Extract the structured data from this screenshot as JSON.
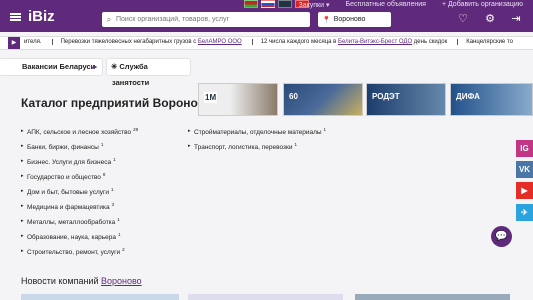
{
  "header": {
    "logo": "iBiz",
    "search_placeholder": "Поиск организаций, товаров, услуг",
    "city": "Вороново",
    "links": [
      "Закупки ▾",
      "Бесплатные объявления",
      "+ Добавить организацию"
    ]
  },
  "ticker": {
    "items": [
      {
        "text": "",
        "link": "ителя."
      },
      {
        "text": "Перевозки тяжеловесных негабаритных грузов с ",
        "link": "БелАМРО ООО"
      },
      {
        "text": "12 числа каждого месяца в ",
        "link": "Белита-Витэкс-Брест ОДО",
        "after": " день скидок"
      },
      {
        "text": "Канцелярские то",
        "link": ""
      }
    ]
  },
  "pills": {
    "vacancies": "Вакансии Беларуси",
    "service": "Служба",
    "service_cont": "занятости"
  },
  "page_title": "Каталог предприятий Вороново",
  "banners": [
    "1М",
    "60",
    "РОДЭТ",
    "ДИФА"
  ],
  "categories_left": [
    {
      "label": "АПК, сельское и лесное хозяйство",
      "count": "28"
    },
    {
      "label": "Банки, биржи, финансы",
      "count": "1"
    },
    {
      "label": "Бизнес. Услуги для бизнеса",
      "count": "1"
    },
    {
      "label": "Государство и общество",
      "count": "8"
    },
    {
      "label": "Дом и быт, бытовые услуги",
      "count": "1"
    },
    {
      "label": "Медицина и фармацевтика",
      "count": "3"
    },
    {
      "label": "Металлы, металлообработка",
      "count": "1"
    },
    {
      "label": "Образование, наука, карьера",
      "count": "1"
    },
    {
      "label": "Строительство, ремонт, услуги",
      "count": "2"
    }
  ],
  "categories_right": [
    {
      "label": "Стройматериалы, отделочные материалы",
      "count": "1"
    },
    {
      "label": "Транспорт, логистика, перевозки",
      "count": "1"
    }
  ],
  "news": {
    "title": "Новости компаний ",
    "city": "Вороново"
  },
  "social": [
    "IG",
    "VK",
    "▶",
    "✈"
  ],
  "colors": {
    "brand": "#5f2a7c"
  }
}
